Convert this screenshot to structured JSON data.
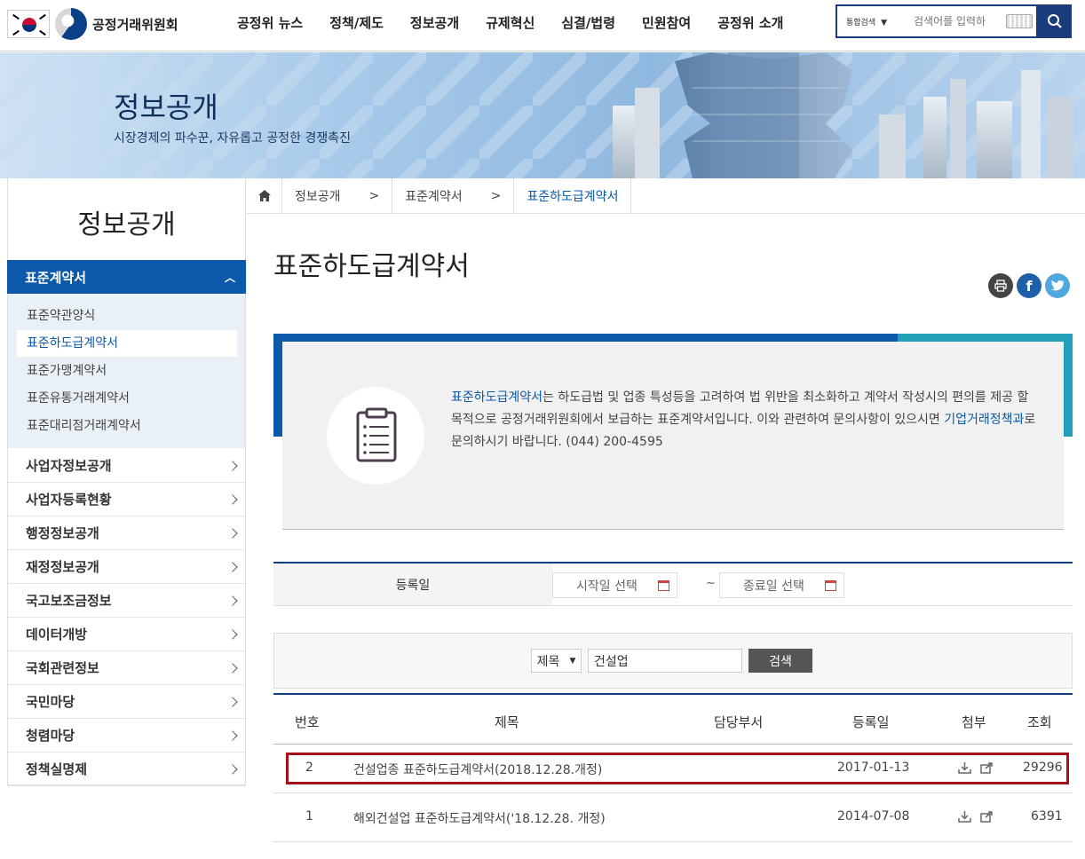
{
  "header": {
    "logo_text": "공정거래위원회",
    "nav": [
      "공정위 뉴스",
      "정책/제도",
      "정보공개",
      "규제혁신",
      "심결/법령",
      "민원참여",
      "공정위 소개"
    ],
    "search_scope": "통합검색",
    "search_placeholder": "검색어를 입력하"
  },
  "banner": {
    "title": "정보공개",
    "subtitle": "시장경제의 파수꾼, 자유롭고 공정한 경쟁촉진"
  },
  "sidebar": {
    "title": "정보공개",
    "active_section": "표준계약서",
    "sub_items": [
      "표준약관양식",
      "표준하도급계약서",
      "표준가맹계약서",
      "표준유통거래계약서",
      "표준대리점거래계약서"
    ],
    "selected_sub": "표준하도급계약서",
    "sections": [
      "사업자정보공개",
      "사업자등록현황",
      "행정정보공개",
      "재정정보공개",
      "국고보조금정보",
      "데이터개방",
      "국회관련정보",
      "국민마당",
      "청렴마당",
      "정책실명제"
    ]
  },
  "breadcrumb": [
    "정보공개",
    "표준계약서",
    "표준하도급계약서"
  ],
  "page_title": "표준하도급계약서",
  "info": {
    "highlight": "표준하도급계약서",
    "text1": "는 하도급법 및 업종 특성등을 고려하여 법 위반을 최소화하고 계약서 작성시의 편의를 제공 할 목적으로 공정거래위원회에서 보급하는 표준계약서입니다. 이와 관련하여 문의사항이 있으시면 ",
    "dept": "기업거래정책과",
    "text2": "로 문의하시기 바랍니다. (044) 200-4595"
  },
  "filter": {
    "label": "등록일",
    "start_placeholder": "시작일 선택",
    "end_placeholder": "종료일 선택",
    "separator": "~"
  },
  "search": {
    "field": "제목",
    "keyword": "건설업",
    "button": "검색"
  },
  "table": {
    "headers": [
      "번호",
      "제목",
      "담당부서",
      "등록일",
      "첨부",
      "조회"
    ],
    "rows": [
      {
        "no": "2",
        "title": "건설업종 표준하도급계약서(2018.12.28.개정)",
        "dept": "",
        "date": "2017-01-13",
        "views": "29296"
      },
      {
        "no": "1",
        "title": "해외건설업 표준하도급계약서('18.12.28. 개정)",
        "dept": "",
        "date": "2014-07-08",
        "views": "6391"
      }
    ]
  },
  "colors": {
    "primary": "#0b59a8",
    "navy": "#0b3f86",
    "teal": "#21a1b8",
    "highlight_border": "#a40f1a"
  }
}
